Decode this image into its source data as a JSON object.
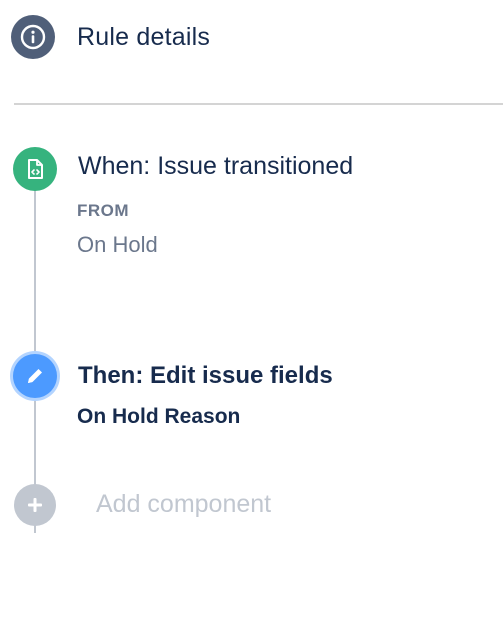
{
  "header": {
    "icon": "info-icon",
    "label": "Rule details"
  },
  "trigger": {
    "icon": "issue-transition-icon",
    "title": "When: Issue transitioned",
    "from_label": "FROM",
    "from_value": "On Hold"
  },
  "action": {
    "icon": "pencil-icon",
    "title": "Then: Edit issue fields",
    "subtitle": "On Hold Reason"
  },
  "add_component": {
    "icon": "plus-icon",
    "label": "Add component"
  },
  "colors": {
    "trigger": "#36B37E",
    "action": "#4C9AFF",
    "add": "#C1C7D0",
    "header_icon": "#505F79"
  }
}
